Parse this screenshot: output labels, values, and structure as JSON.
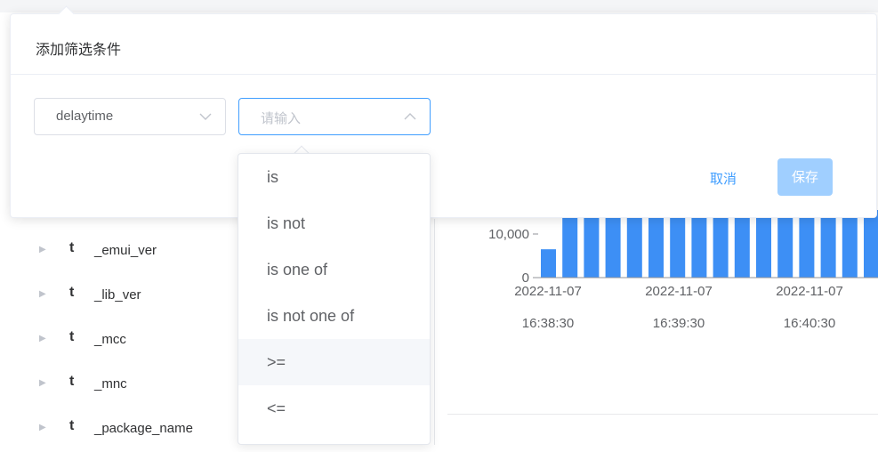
{
  "filter_popover": {
    "title": "添加筛选条件",
    "field_select": {
      "value": "delaytime"
    },
    "operator_select": {
      "placeholder": "请输入"
    },
    "cancel_label": "取消",
    "save_label": "保存"
  },
  "operator_dropdown": {
    "options": [
      "is",
      "is not",
      "is one of",
      "is not one of",
      ">=",
      "<="
    ],
    "hovered_option": ">="
  },
  "field_list": {
    "items": [
      {
        "type": "t",
        "name": "_emui_ver"
      },
      {
        "type": "t",
        "name": "_lib_ver"
      },
      {
        "type": "t",
        "name": "_mcc"
      },
      {
        "type": "t",
        "name": "_mnc"
      },
      {
        "type": "t",
        "name": "_package_name"
      }
    ]
  },
  "chart_data": {
    "type": "bar",
    "y_ticks": [
      "0",
      "10,000"
    ],
    "x_ticks": [
      {
        "date": "2022-11-07",
        "time": "16:38:30"
      },
      {
        "date": "2022-11-07",
        "time": "16:39:30"
      },
      {
        "date": "2022-11-07",
        "time": "16:40:30"
      }
    ],
    "values": [
      6500,
      20000,
      20000,
      20000,
      20000,
      20000,
      20000,
      20000,
      20000,
      20000,
      20000,
      20000,
      20000,
      20000,
      20000,
      20000,
      20000,
      20000,
      20000,
      20000
    ],
    "bar_color": "#3d8ff5"
  },
  "bottom_caption": "—",
  "colors": {
    "primary": "#409eff",
    "save_disabled": "#a0cfff",
    "bar": "#3d8ff5"
  }
}
